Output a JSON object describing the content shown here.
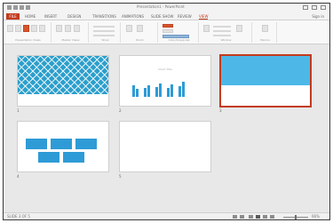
{
  "window": {
    "title": "Presentation1 - PowerPoint",
    "sign_in": "Sign in"
  },
  "tabs": [
    {
      "label": "FILE"
    },
    {
      "label": "HOME"
    },
    {
      "label": "INSERT"
    },
    {
      "label": "DESIGN"
    },
    {
      "label": "TRANSITIONS"
    },
    {
      "label": "ANIMATIONS"
    },
    {
      "label": "SLIDE SHOW"
    },
    {
      "label": "REVIEW"
    },
    {
      "label": "VIEW"
    }
  ],
  "active_tab": "VIEW",
  "ribbon_groups": [
    {
      "label": "Presentation Views"
    },
    {
      "label": "Master Views"
    },
    {
      "label": "Show"
    },
    {
      "label": "Zoom"
    },
    {
      "label": "Color/Grayscale"
    },
    {
      "label": "Window"
    },
    {
      "label": "Macros"
    }
  ],
  "slides": [
    {
      "number": "1",
      "kind": "pattern"
    },
    {
      "number": "2",
      "kind": "chart",
      "caption": "Chart Title"
    },
    {
      "number": "3",
      "kind": "title-bar",
      "selected": true
    },
    {
      "number": "4",
      "kind": "boxes"
    },
    {
      "number": "5",
      "kind": "blank"
    }
  ],
  "status": {
    "text": "SLIDE 3 OF 5",
    "zoom": "66%"
  },
  "colors": {
    "accent": "#c33b1e",
    "slide_blue": "#2e9bd6"
  }
}
